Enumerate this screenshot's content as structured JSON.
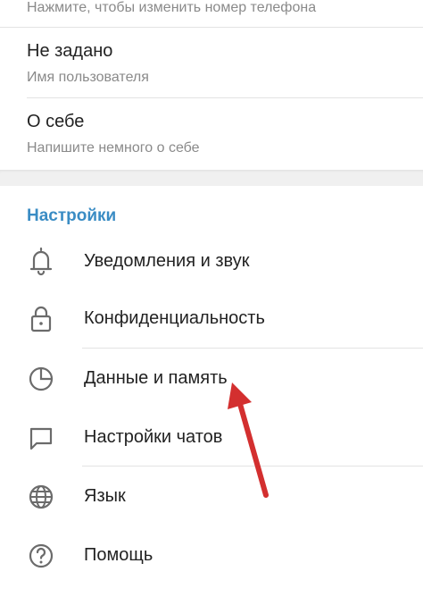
{
  "account": {
    "phone_hint": "Нажмите, чтобы изменить номер телефона",
    "username_value": "Не задано",
    "username_label": "Имя пользователя",
    "bio_title": "О себе",
    "bio_hint": "Напишите немного о себе"
  },
  "settings": {
    "header": "Настройки",
    "items": [
      {
        "label": "Уведомления и звук",
        "icon": "bell-icon"
      },
      {
        "label": "Конфиденциальность",
        "icon": "lock-icon"
      },
      {
        "label": "Данные и память",
        "icon": "pie-chart-icon"
      },
      {
        "label": "Настройки чатов",
        "icon": "chat-bubble-icon"
      },
      {
        "label": "Язык",
        "icon": "globe-icon"
      },
      {
        "label": "Помощь",
        "icon": "help-icon"
      }
    ]
  },
  "colors": {
    "accent": "#3a8cc4",
    "annotation_arrow": "#d32f2f",
    "text_primary": "#222222",
    "text_secondary": "#8a8a8a"
  }
}
